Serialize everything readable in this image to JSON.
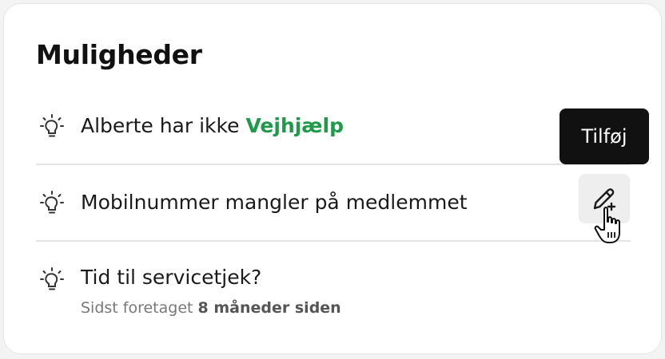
{
  "card": {
    "title": "Muligheder",
    "items": [
      {
        "icon": "lightbulb-icon",
        "text": "Alberte har ikke ",
        "highlight": "Vejhjælp"
      },
      {
        "icon": "lightbulb-icon",
        "text": "Mobilnummer mangler på medlemmet",
        "action": {
          "icon": "pencil-plus-icon"
        }
      },
      {
        "icon": "lightbulb-icon",
        "text": "Tid til servicetjek?",
        "sub_prefix": "Sidst foretaget ",
        "sub_bold": "8 måneder siden"
      }
    ]
  },
  "tooltip": {
    "label": "Tilføj"
  },
  "colors": {
    "highlight": "#1f9a49",
    "tooltip_bg": "#111111",
    "button_bg": "#eeeeee"
  }
}
